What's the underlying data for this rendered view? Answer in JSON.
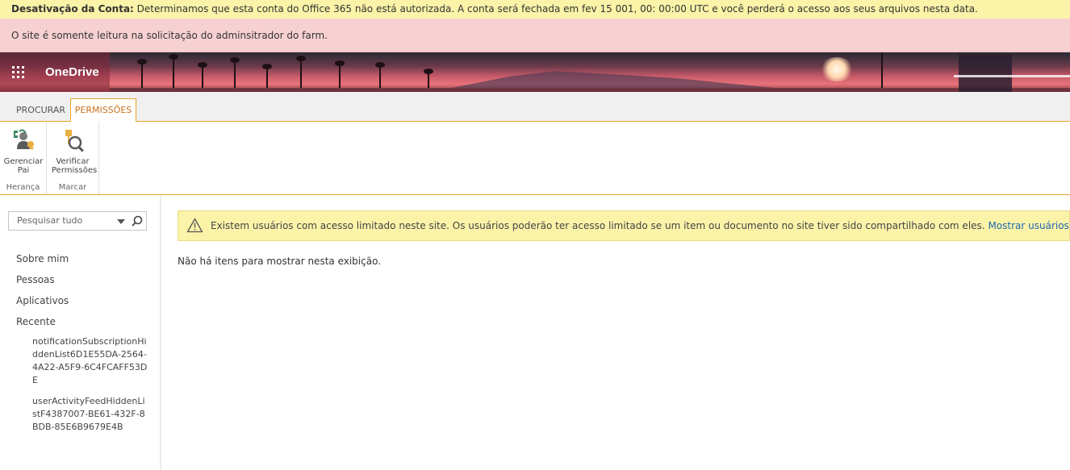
{
  "banners": {
    "deactivation_title": "Desativação da Conta:",
    "deactivation_text": " Determinamos que esta conta do Office 365 não está autorizada. A conta será fechada em fev 15 001, 00: 00:00 UTC e você perderá o acesso aos seus arquivos nesta data.",
    "readonly_text": "O site é somente leitura na solicitação do adminsitrador do farm."
  },
  "suitebar": {
    "app_name": "OneDrive",
    "launcher_icon": "app-launcher-icon"
  },
  "ribbon": {
    "tabs": [
      {
        "label": "PROCURAR",
        "active": false
      },
      {
        "label": "PERMISSÕES",
        "active": true
      }
    ],
    "groups": [
      {
        "label": "Herança",
        "buttons": [
          {
            "line1": "Gerenciar",
            "line2": "Pai",
            "icon": "manage-parent-icon"
          }
        ]
      },
      {
        "label": "Marcar",
        "buttons": [
          {
            "line1": "Verificar",
            "line2": "Permissões",
            "icon": "check-permissions-icon"
          }
        ]
      }
    ]
  },
  "leftnav": {
    "search_placeholder": "Pesquisar tudo",
    "items": [
      "Sobre mim",
      "Pessoas",
      "Aplicativos",
      "Recente"
    ],
    "recent": [
      "notificationSubscriptionHiddenList6D1E55DA-2564-4A22-A5F9-6C4FCAFF53DE",
      "userActivityFeedHiddenListF4387007-BE61-432F-8BDB-85E6B9679E4B"
    ]
  },
  "main": {
    "warning_text": "Existem usuários com acesso limitado neste site. Os usuários poderão ter acesso limitado se um item ou documento no site tiver sido compartilhado com eles.",
    "warning_link": "Mostrar usuários.",
    "empty_text": "Não há itens para mostrar nesta exibição."
  },
  "colors": {
    "accent": "#e8a528",
    "link": "#2167b3",
    "warning_bg": "#fbf3a8",
    "error_bg": "#f7d1d2"
  }
}
